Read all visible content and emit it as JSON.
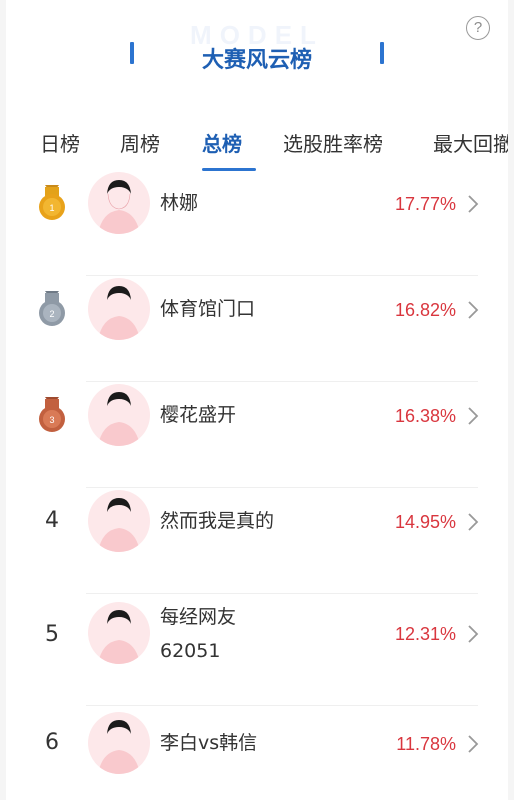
{
  "header": {
    "watermark": "MODEL",
    "title": "大赛风云榜"
  },
  "help_icon": "question-circle-icon",
  "tabs": [
    {
      "label": "日榜",
      "active": false
    },
    {
      "label": "周榜",
      "active": false
    },
    {
      "label": "总榜",
      "active": true
    },
    {
      "label": "选股胜率榜",
      "active": false
    },
    {
      "label": "最大回撤",
      "active": false
    }
  ],
  "rankings": [
    {
      "rank": "1",
      "medal": "gold",
      "name": "林娜",
      "name2": "",
      "return": "17.77%"
    },
    {
      "rank": "2",
      "medal": "silver",
      "name": "体育馆门口",
      "name2": "",
      "return": "16.82%"
    },
    {
      "rank": "3",
      "medal": "bronze",
      "name": "樱花盛开",
      "name2": "",
      "return": "16.38%"
    },
    {
      "rank": "4",
      "medal": "",
      "name": "然而我是真的",
      "name2": "",
      "return": "14.95%"
    },
    {
      "rank": "5",
      "medal": "",
      "name": "每经网友",
      "name2": "62051",
      "return": "12.31%"
    },
    {
      "rank": "6",
      "medal": "",
      "name": "李白vs韩信",
      "name2": "",
      "return": "11.78%"
    }
  ],
  "colors": {
    "accent": "#1e5fb3",
    "positive": "#d9363e",
    "gold": "#e3a21a",
    "silver": "#8f9aa6",
    "bronze": "#c2603f"
  }
}
